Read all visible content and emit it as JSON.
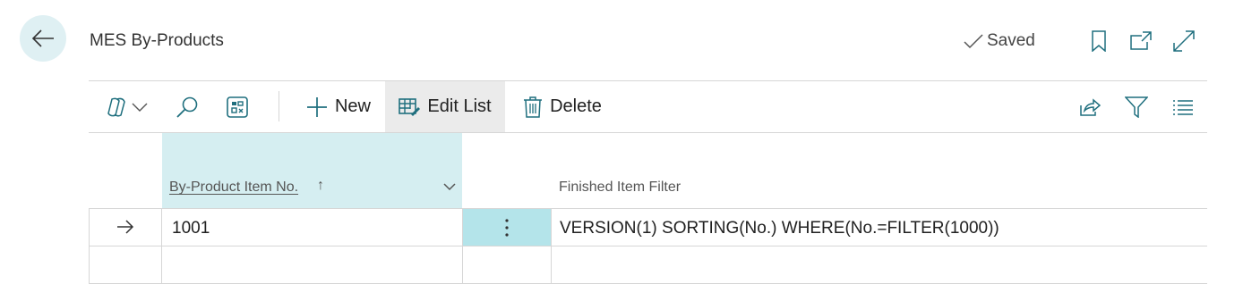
{
  "header": {
    "title": "MES By-Products",
    "saved_label": "Saved"
  },
  "toolbar": {
    "new_label": "New",
    "edit_list_label": "Edit List",
    "delete_label": "Delete"
  },
  "table": {
    "columns": {
      "item_no": "By-Product Item No.",
      "filter": "Finished Item Filter"
    },
    "sort_indicator": "↑",
    "rows": [
      {
        "item_no": "1001",
        "filter": "VERSION(1) SORTING(No.) WHERE(No.=FILTER(1000))"
      }
    ]
  },
  "colors": {
    "accent_light": "#d5eef1",
    "selected_cell": "#b4e4ea",
    "back_button": "#dff0f3",
    "icon_teal": "#1f6f7e"
  }
}
